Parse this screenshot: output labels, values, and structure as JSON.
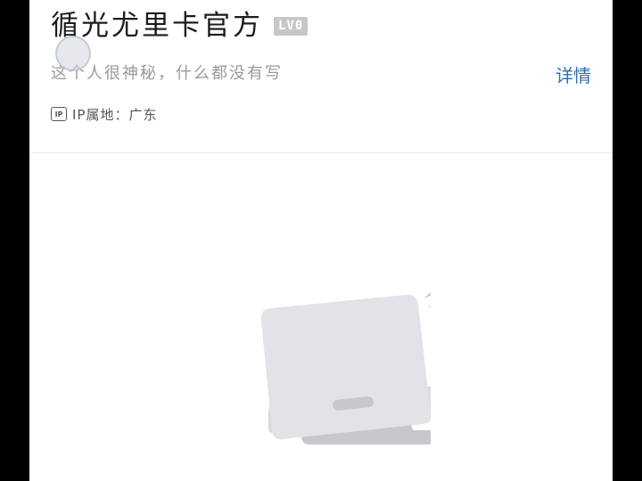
{
  "profile": {
    "name": "循光尤里卡官方",
    "level_badge": "LV0",
    "bio": "这个人很神秘，什么都没有写",
    "details_label": "详情",
    "ip_icon_label": "IP",
    "ip_location": "IP属地：广东"
  },
  "content": {
    "state": "empty",
    "illustration_icon": "empty-laptop-illustration"
  },
  "colors": {
    "link": "#2a6fb0",
    "name": "#1c1c1c",
    "bio": "#9a9a9a",
    "badge_bg": "#c7c7c9",
    "illustration": "#e1e3e7"
  }
}
